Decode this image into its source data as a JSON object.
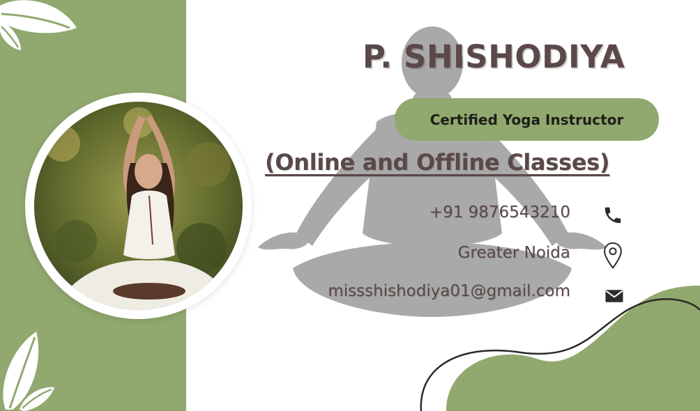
{
  "card": {
    "name": "P. SHISHODIYA",
    "title": "Certified Yoga Instructor",
    "subtitle": "(Online and Offline Classes)"
  },
  "contact": {
    "phone": "+91 9876543210",
    "location": "Greater Noida",
    "email": "missshishodiya01@gmail.com"
  },
  "icons": {
    "phone": "phone-icon",
    "location": "map-pin-icon",
    "email": "envelope-icon",
    "leaf": "leaf-icon",
    "silhouette": "meditation-silhouette"
  },
  "colors": {
    "accent_green": "#91a86f",
    "text_brown": "#5b4848",
    "silhouette_gray": "#a9a9a9"
  }
}
